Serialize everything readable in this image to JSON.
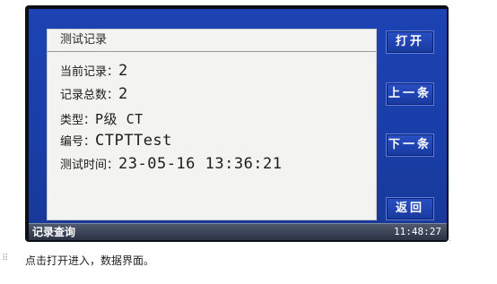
{
  "panel": {
    "title": "测试记录",
    "rows": [
      {
        "label": "当前记录：",
        "value": "2"
      },
      {
        "label": "记录总数：",
        "value": "2"
      },
      {
        "label": "类型：",
        "value": "P级 CT"
      },
      {
        "label": "编号：",
        "value": "CTPTTest"
      },
      {
        "label": "测试时间：",
        "value": "23-05-16 13:36:21"
      }
    ]
  },
  "buttons": {
    "open": "打开",
    "prev": "上一条",
    "next": "下一条",
    "back": "返回"
  },
  "status_bar": {
    "title": "记录查询",
    "clock": "11:48:27"
  },
  "caption": "点击打开进入，数据界面。",
  "icons": [
    "drag-handle-icon"
  ],
  "colors": {
    "screen_blue": "#1a3ea8",
    "panel_bg": "#f3f3f1",
    "button_blue": "#2a4fc4",
    "status_bar": "#3b4457"
  }
}
